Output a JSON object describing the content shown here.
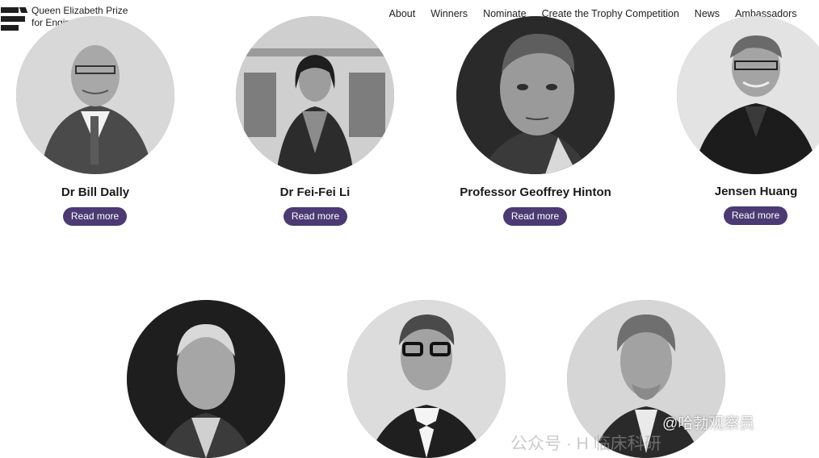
{
  "brand": {
    "line1": "Queen Elizabeth Prize",
    "line2": "for Engineering",
    "logo_icon": "qeprize-stacked-bars-logo"
  },
  "nav": {
    "items": [
      "About",
      "Winners",
      "Nominate",
      "Create the Trophy Competition",
      "News",
      "Ambassadors"
    ]
  },
  "people": [
    {
      "name": "Dr Bill Dally",
      "button": "Read more"
    },
    {
      "name": "Dr Fei-Fei Li",
      "button": "Read more"
    },
    {
      "name": "Professor Geoffrey Hinton",
      "button": "Read more"
    },
    {
      "name": "Jensen Huang",
      "button": "Read more"
    },
    {
      "name": "",
      "button": ""
    },
    {
      "name": "",
      "button": ""
    },
    {
      "name": "",
      "button": ""
    }
  ],
  "colors": {
    "button_bg": "#4b3a73",
    "button_text": "#ffffff",
    "text": "#1a1a1a",
    "background": "#ffffff"
  },
  "watermarks": {
    "weibo": "@哈勃观察员",
    "wechat": "公众号 · H 临床科研"
  }
}
